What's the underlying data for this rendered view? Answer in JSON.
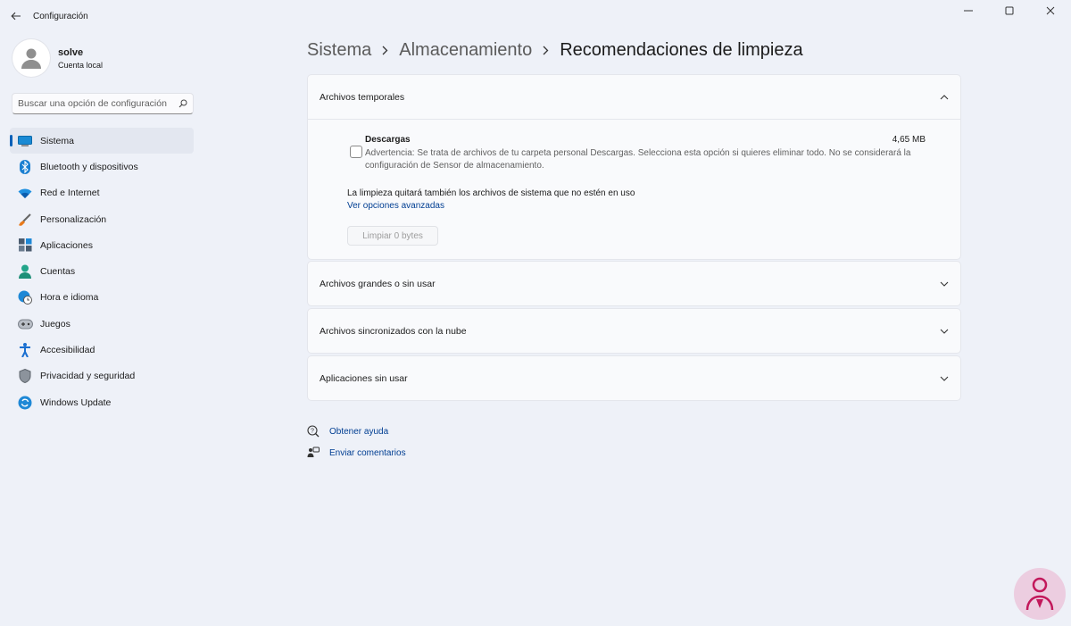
{
  "window": {
    "title": "Configuración"
  },
  "profile": {
    "name": "solve",
    "account_type": "Cuenta local"
  },
  "search": {
    "placeholder": "Buscar una opción de configuración"
  },
  "sidebar": {
    "items": [
      {
        "label": "Sistema",
        "icon": "system-icon",
        "active": true
      },
      {
        "label": "Bluetooth y dispositivos",
        "icon": "bluetooth-icon"
      },
      {
        "label": "Red e Internet",
        "icon": "wifi-icon"
      },
      {
        "label": "Personalización",
        "icon": "brush-icon"
      },
      {
        "label": "Aplicaciones",
        "icon": "apps-icon"
      },
      {
        "label": "Cuentas",
        "icon": "accounts-icon"
      },
      {
        "label": "Hora e idioma",
        "icon": "globe-clock-icon"
      },
      {
        "label": "Juegos",
        "icon": "gamepad-icon"
      },
      {
        "label": "Accesibilidad",
        "icon": "accessibility-icon"
      },
      {
        "label": "Privacidad y seguridad",
        "icon": "shield-icon"
      },
      {
        "label": "Windows Update",
        "icon": "update-icon"
      }
    ]
  },
  "breadcrumb": {
    "level1": "Sistema",
    "level2": "Almacenamiento",
    "current": "Recomendaciones de limpieza"
  },
  "sections": {
    "temp_files": {
      "title": "Archivos temporales",
      "expanded": true,
      "item_title": "Descargas",
      "item_size": "4,65 MB",
      "item_checked": false,
      "item_description": "Advertencia: Se trata de archivos de tu carpeta personal Descargas. Selecciona esta opción si quieres eliminar todo. No se considerará la configuración de Sensor de almacenamiento.",
      "note": "La limpieza quitará también los archivos de sistema que no estén en uso",
      "advanced_link": "Ver opciones avanzadas",
      "clean_button": "Limpiar 0 bytes"
    },
    "large_files": {
      "title": "Archivos grandes o sin usar"
    },
    "cloud_files": {
      "title": "Archivos sincronizados con la nube"
    },
    "unused_apps": {
      "title": "Aplicaciones sin usar"
    }
  },
  "help_links": {
    "help": "Obtener ayuda",
    "feedback": "Enviar comentarios"
  },
  "colors": {
    "accent": "#005fb8",
    "link": "#003e92",
    "background": "#eef1f8",
    "watermark": "#e1005a"
  }
}
